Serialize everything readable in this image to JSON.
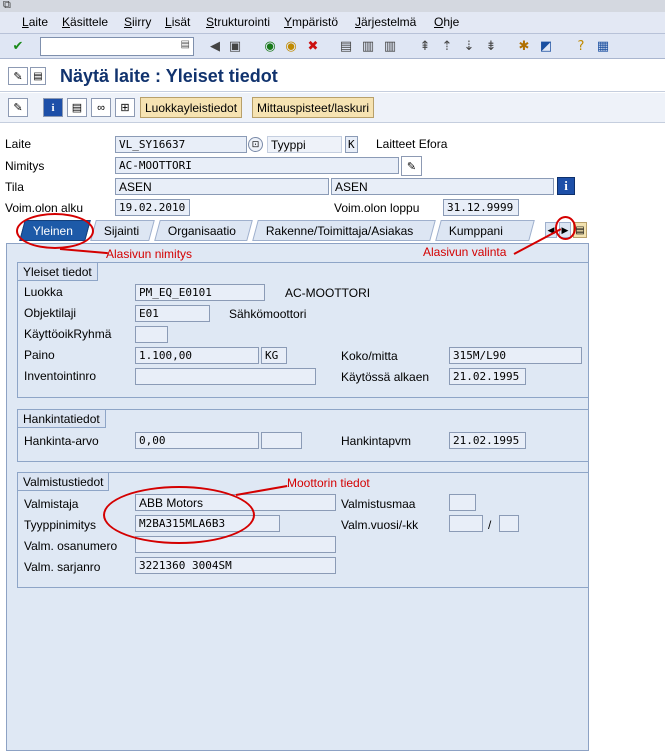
{
  "menu": [
    "Laite",
    "Käsittele",
    "Siirry",
    "Lisät",
    "Strukturointi",
    "Ympäristö",
    "Järjestelmä",
    "Ohje"
  ],
  "app_title": "Näytä laite : Yleiset tiedot",
  "app_buttons": {
    "class_data": "Luokkayleistiedot",
    "measuring_points": "Mittauspisteet/laskuri"
  },
  "header": {
    "laite_label": "Laite",
    "laite_value": "VL_SY16637",
    "tyyppi_label": "Tyyppi",
    "tyyppi_value": "K",
    "tyyppi_text": "Laitteet Efora",
    "nimitys_label": "Nimitys",
    "nimitys_value": "AC-MOOTTORI",
    "tila_label": "Tila",
    "tila_value1": "ASEN",
    "tila_value2": "ASEN",
    "alku_label": "Voim.olon alku",
    "alku_value": "19.02.2010",
    "loppu_label": "Voim.olon loppu",
    "loppu_value": "31.12.9999"
  },
  "tabs": [
    "Yleinen",
    "Sijainti",
    "Organisaatio",
    "Rakenne/Toimittaja/Asiakas",
    "Kumppani"
  ],
  "active_tab": "Yleinen",
  "annotations": {
    "tab_name": "Alasivun nimitys",
    "tab_select": "Alasivun valinta",
    "motor": "Moottorin tiedot"
  },
  "general": {
    "title": "Yleiset tiedot",
    "luokka_label": "Luokka",
    "luokka_value": "PM_EQ_E0101",
    "luokka_text": "AC-MOOTTORI",
    "objektilaji_label": "Objektilaji",
    "objektilaji_value": "E01",
    "objektilaji_text": "Sähkömoottori",
    "kayttoryhma_label": "KäyttöoikRyhmä",
    "kayttoryhma_value": "",
    "paino_label": "Paino",
    "paino_value": "1.100,00",
    "paino_unit": "KG",
    "koko_label": "Koko/mitta",
    "koko_value": "315M/L90",
    "inventointinro_label": "Inventointinro",
    "inventointinro_value": "",
    "kaytossa_label": "Käytössä alkaen",
    "kaytossa_value": "21.02.1995"
  },
  "acquisition": {
    "title": "Hankintatiedot",
    "arvo_label": "Hankinta-arvo",
    "arvo_value": "0,00",
    "arvo_currency": "",
    "pvm_label": "Hankintapvm",
    "pvm_value": "21.02.1995"
  },
  "manufacturer": {
    "title": "Valmistustiedot",
    "valmistaja_label": "Valmistaja",
    "valmistaja_value": "ABB Motors",
    "maa_label": "Valmistusmaa",
    "maa_value": "",
    "tyyppinimitys_label": "Tyyppinimitys",
    "tyyppinimitys_value": "M2BA315MLA6B3",
    "vuosi_label": "Valm.vuosi/-kk",
    "vuosi_value": "",
    "vuosi_sep": "/",
    "kk_value": "",
    "osanumero_label": "Valm. osanumero",
    "osanumero_value": "",
    "sarjanro_label": "Valm. sarjanro",
    "sarjanro_value": "3221360 3004SM"
  }
}
